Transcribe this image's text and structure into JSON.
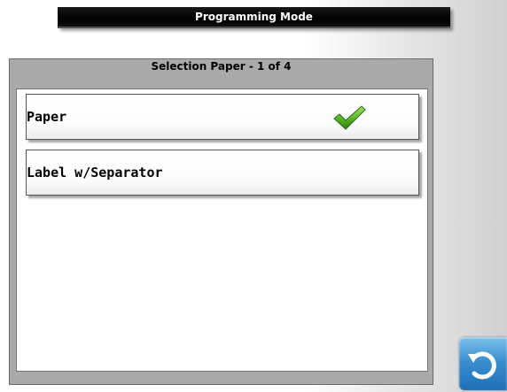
{
  "header": {
    "title": "Programming Mode"
  },
  "panel": {
    "title": "Selection Paper - 1 of 4",
    "items": [
      {
        "label": "Paper",
        "selected": true
      },
      {
        "label": "Label w/Separator",
        "selected": false
      }
    ]
  },
  "icons": {
    "selected_indicator": "checkmark-icon",
    "back": "back-arrow-icon"
  },
  "colors": {
    "checkmark": "#5cb82a",
    "back_button": "#2b7ec4"
  }
}
